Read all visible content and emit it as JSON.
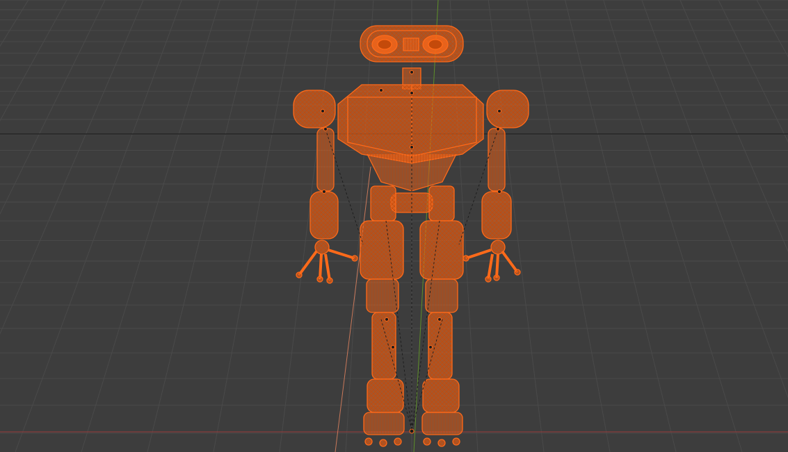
{
  "viewport": {
    "background_color": "#3d3d3d",
    "grid_color": "#4a4a4a",
    "horizon_color": "#1f1f1f",
    "x_axis_color": "#9b3a3a",
    "y_axis_color": "#5e8f2a",
    "selection_color": "#ff6a1a",
    "selection_dark_color": "#c44a0a",
    "armature_color": "#1a1a1a"
  },
  "scene": {
    "object_icon": "robot-armature-icon"
  }
}
